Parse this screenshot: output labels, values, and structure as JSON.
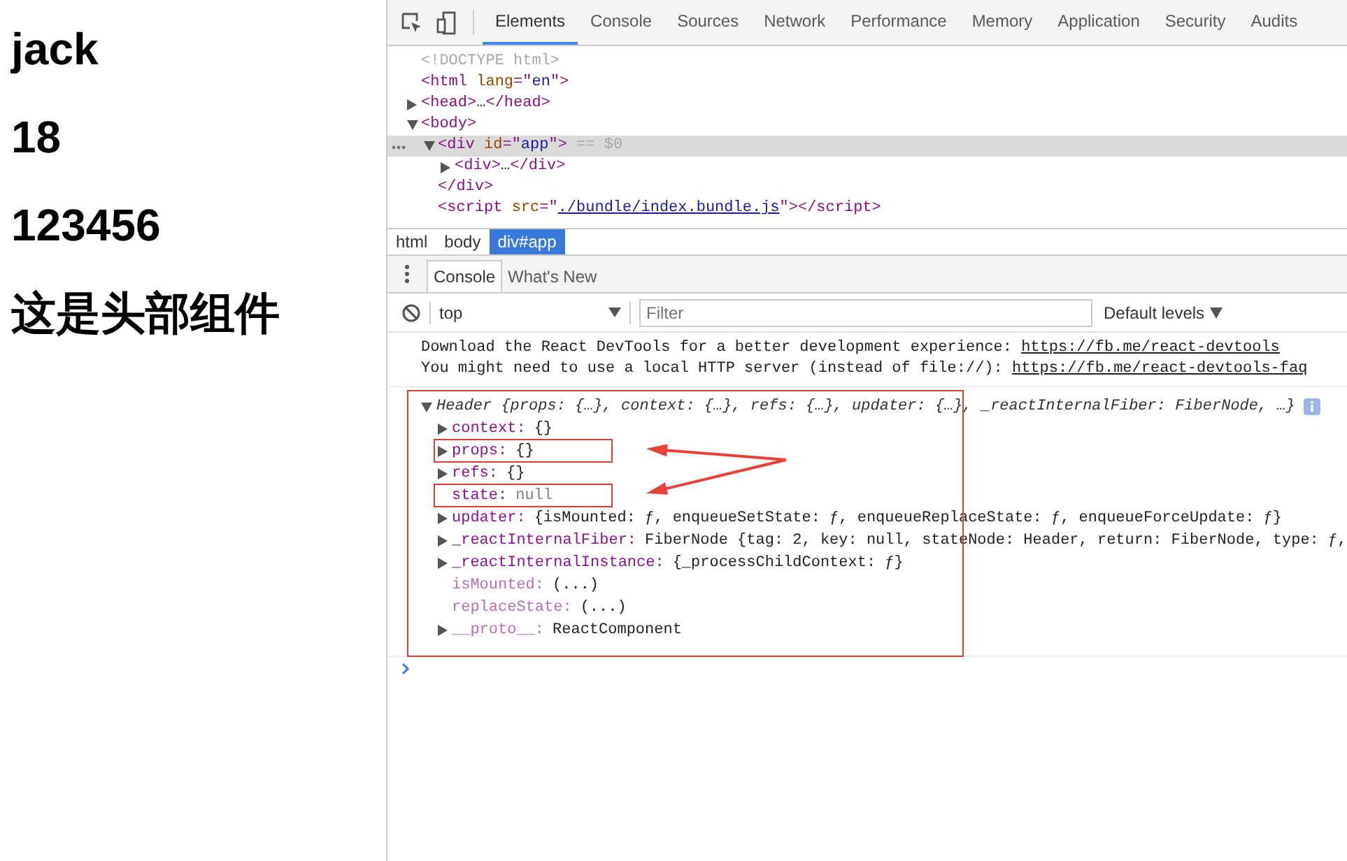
{
  "page": {
    "headings": [
      "jack",
      "18",
      "123456",
      "这是头部组件"
    ]
  },
  "devtools": {
    "tabs": [
      {
        "label": "Elements",
        "selected": true
      },
      {
        "label": "Console",
        "selected": false
      },
      {
        "label": "Sources",
        "selected": false
      },
      {
        "label": "Network",
        "selected": false
      },
      {
        "label": "Performance",
        "selected": false
      },
      {
        "label": "Memory",
        "selected": false
      },
      {
        "label": "Application",
        "selected": false
      },
      {
        "label": "Security",
        "selected": false
      },
      {
        "label": "Audits",
        "selected": false
      }
    ],
    "elements": [
      {
        "selected": false,
        "tokens": [
          {
            "kind": "gray",
            "text": "<!DOCTYPE html>"
          }
        ]
      },
      {
        "selected": false,
        "tokens": [
          {
            "kind": "tag",
            "text": "<html"
          },
          {
            "kind": "attr",
            "text": " lang"
          },
          {
            "kind": "tag",
            "text": "=\""
          },
          {
            "kind": "val",
            "text": "en"
          },
          {
            "kind": "tag",
            "text": "\">"
          }
        ]
      },
      {
        "expanded": false,
        "selected": false,
        "tokens": [
          {
            "kind": "tag",
            "text": "<head>"
          },
          {
            "kind": "text",
            "text": "…"
          },
          {
            "kind": "tag",
            "text": "</head>"
          }
        ]
      },
      {
        "expanded": true,
        "selected": false,
        "tokens": [
          {
            "kind": "tag",
            "text": "<body>"
          }
        ],
        "children": [
          {
            "expanded": true,
            "selected": true,
            "tokens": [
              {
                "kind": "tag",
                "text": "<div"
              },
              {
                "kind": "attr",
                "text": " id"
              },
              {
                "kind": "tag",
                "text": "=\""
              },
              {
                "kind": "val",
                "text": "app"
              },
              {
                "kind": "tag",
                "text": "\">"
              },
              {
                "kind": "gray",
                "text": " == $0"
              }
            ],
            "children": [
              {
                "expanded": false,
                "selected": false,
                "tokens": [
                  {
                    "kind": "tag",
                    "text": "<div>"
                  },
                  {
                    "kind": "text",
                    "text": "…"
                  },
                  {
                    "kind": "tag",
                    "text": "</div>"
                  }
                ]
              }
            ]
          },
          {
            "selected": false,
            "tokens": [
              {
                "kind": "tag",
                "text": "</div>"
              }
            ]
          },
          {
            "selected": false,
            "tokens": [
              {
                "kind": "tag",
                "text": "<script"
              },
              {
                "kind": "attr",
                "text": " src"
              },
              {
                "kind": "tag",
                "text": "=\""
              },
              {
                "kind": "link",
                "text": "./bundle/index.bundle.js"
              },
              {
                "kind": "tag",
                "text": "\"></script>"
              }
            ]
          }
        ]
      }
    ],
    "breadcrumbs": [
      {
        "label": "html",
        "selected": false
      },
      {
        "label": "body",
        "selected": false
      },
      {
        "label": "div#app",
        "selected": true
      }
    ],
    "drawer_tabs": [
      {
        "label": "Console",
        "selected": true
      },
      {
        "label": "What's New",
        "selected": false
      }
    ],
    "context": "top",
    "filter_placeholder": "Filter",
    "levels": "Default levels",
    "messages": [
      {
        "text": "Download the React DevTools for a better development experience: ",
        "link": "https://fb.me/react-devtools"
      },
      {
        "text": "You might need to use a local HTTP server (instead of file://): ",
        "link": "https://fb.me/react-devtools-faq"
      }
    ],
    "object": {
      "summary": "Header {props: {…}, context: {…}, refs: {…}, updater: {…}, _reactInternalFiber: FiberNode, …}",
      "expanded": true,
      "outlined": true,
      "properties": [
        {
          "key": "context:",
          "value": "{}",
          "expanded": false,
          "dim": false,
          "kind": "value",
          "highlighted": false
        },
        {
          "key": "props:",
          "value": "{}",
          "expanded": false,
          "dim": false,
          "kind": "value",
          "highlighted": true
        },
        {
          "key": "refs:",
          "value": "{}",
          "expanded": false,
          "dim": false,
          "kind": "value",
          "highlighted": false
        },
        {
          "key": "state:",
          "value": "null",
          "dim": false,
          "kind": "null",
          "highlighted": true
        },
        {
          "key": "updater:",
          "value": "{isMounted: ƒ, enqueueSetState: ƒ, enqueueReplaceState: ƒ, enqueueForceUpdate: ƒ}",
          "expanded": false,
          "dim": false,
          "kind": "value",
          "highlighted": false
        },
        {
          "key": "_reactInternalFiber:",
          "value": "FiberNode {tag: 2, key: null, stateNode: Header, return: FiberNode, type: ƒ,",
          "expanded": false,
          "dim": false,
          "kind": "value",
          "highlighted": false
        },
        {
          "key": "_reactInternalInstance:",
          "value": "{_processChildContext: ƒ}",
          "expanded": false,
          "dim": false,
          "kind": "value",
          "highlighted": false
        },
        {
          "key": "isMounted:",
          "value": "(...)",
          "dim": true,
          "kind": "value",
          "highlighted": false
        },
        {
          "key": "replaceState:",
          "value": "(...)",
          "dim": true,
          "kind": "value",
          "highlighted": false
        },
        {
          "key": "__proto__:",
          "value": "ReactComponent",
          "expanded": false,
          "dim": true,
          "kind": "value",
          "highlighted": false
        }
      ]
    }
  }
}
